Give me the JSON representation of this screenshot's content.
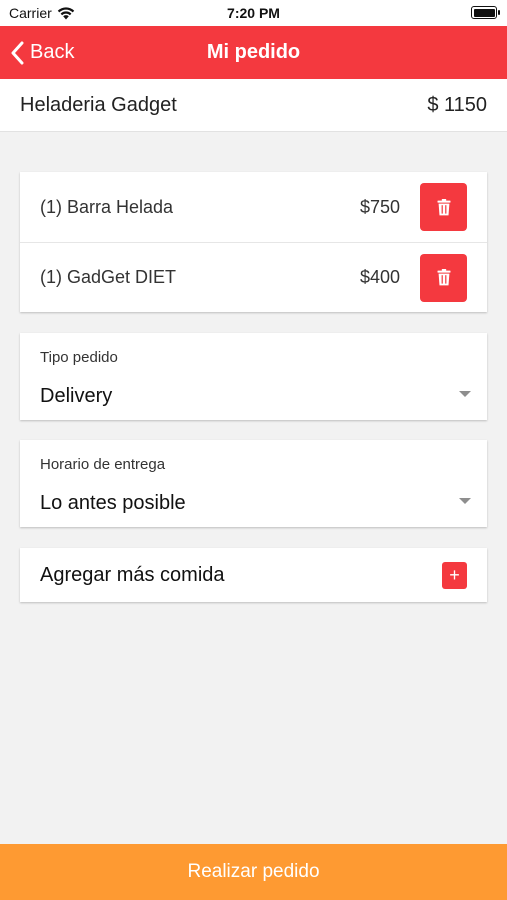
{
  "status_bar": {
    "carrier": "Carrier",
    "time": "7:20 PM"
  },
  "nav": {
    "back_label": "Back",
    "title": "Mi pedido"
  },
  "shop": {
    "name": "Heladeria Gadget",
    "total": "$ 1150"
  },
  "order_items": [
    {
      "name": "(1) Barra Helada",
      "price": "$750",
      "delete_icon": "trash-icon"
    },
    {
      "name": "(1) GadGet DIET",
      "price": "$400",
      "delete_icon": "trash-icon"
    }
  ],
  "order_type": {
    "label": "Tipo pedido",
    "value": "Delivery"
  },
  "delivery_time": {
    "label": "Horario de entrega",
    "value": "Lo antes posible"
  },
  "add_more": {
    "label": "Agregar más comida",
    "icon": "+"
  },
  "submit": {
    "label": "Realizar pedido"
  },
  "colors": {
    "primary_red": "#f4393f",
    "submit_orange": "#fe9a32",
    "background": "#f2f2f2"
  }
}
